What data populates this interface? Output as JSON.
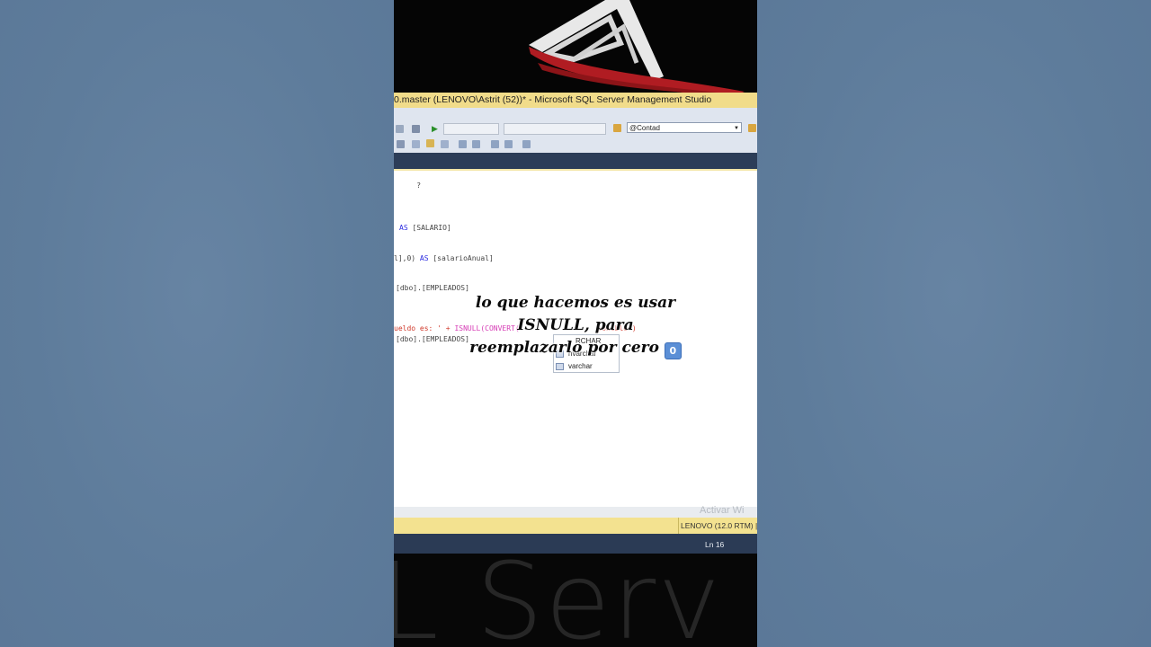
{
  "window": {
    "title": "0.master (LENOVO\\Astrit (52))* - Microsoft SQL Server Management Studio"
  },
  "toolbar": {
    "database_combo": "@Contad"
  },
  "editor": {
    "lines": [
      {
        "id": "l1",
        "parts": [
          {
            "text": "?",
            "cls": "gr"
          }
        ]
      },
      {
        "id": "l2",
        "parts": [
          {
            "text": "AS",
            "cls": "kw"
          },
          {
            "text": " [SALARIO]",
            "cls": "gr"
          }
        ]
      },
      {
        "id": "l3",
        "parts": [
          {
            "text": "l],0) ",
            "cls": "gr"
          },
          {
            "text": "AS",
            "cls": "kw"
          },
          {
            "text": " [salarioAnual]",
            "cls": "gr"
          }
        ]
      },
      {
        "id": "l4",
        "parts": [
          {
            "text": "[dbo].[EMPLEADOS]",
            "cls": "gr"
          }
        ]
      },
      {
        "id": "l5",
        "parts": [
          {
            "text": "ueldo es: ' + ",
            "cls": "str"
          },
          {
            "text": "ISNULL(CONVERT(",
            "cls": "pink"
          },
          {
            "text": "                  ",
            "cls": "gr"
          },
          {
            "text": "ponible')",
            "cls": "str"
          }
        ]
      },
      {
        "id": "l6",
        "parts": [
          {
            "text": "[dbo].[EMPLEADOS]",
            "cls": "gr"
          }
        ]
      }
    ]
  },
  "autocomplete": {
    "items": [
      "RCHAR",
      "nvarchar",
      "varchar"
    ]
  },
  "watermark": "Activar Wi",
  "status": {
    "server": "LENOVO (12.0 RTM)",
    "server_suffix": "| L",
    "line": "Ln 16"
  },
  "background_text": "L Serv",
  "caption": {
    "line1": "lo que hacemos es usar",
    "line2": "ISNULL, para",
    "line3": "reemplazarlo por cero",
    "keycap": "0"
  }
}
